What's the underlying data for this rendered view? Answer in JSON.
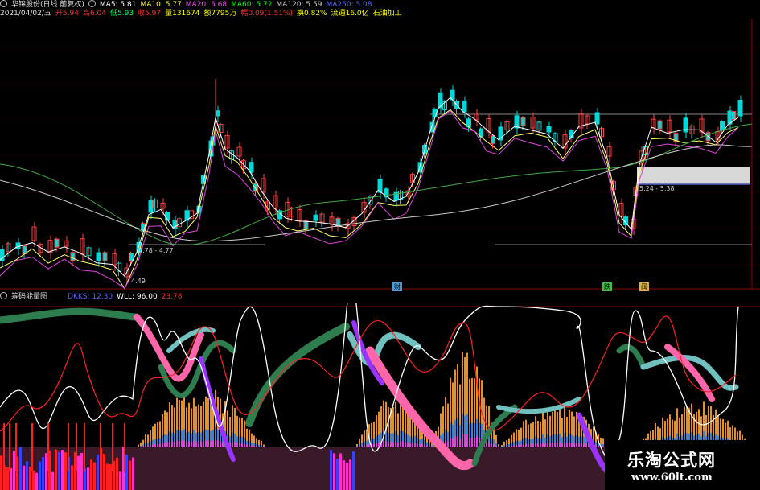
{
  "header": {
    "stock_name": "华锦股份(日线 前复权)",
    "ma_labels": [
      {
        "text": "MA5: 5.81",
        "color": "#ffffff"
      },
      {
        "text": "MA10: 5.77",
        "color": "#ffff00"
      },
      {
        "text": "MA20: 5.68",
        "color": "#ff44ff"
      },
      {
        "text": "MA60: 5.72",
        "color": "#00ff00"
      },
      {
        "text": "MA120: 5.59",
        "color": "#cccccc"
      },
      {
        "text": "MA250: 5.08",
        "color": "#5566ff"
      }
    ],
    "date": "2021/04/02/五",
    "quote": [
      {
        "label": "开",
        "value": "5.94",
        "color": "#ff3333"
      },
      {
        "label": "高",
        "value": "6.04",
        "color": "#ff3333"
      },
      {
        "label": "低",
        "value": "5.93",
        "color": "#00ff66"
      },
      {
        "label": "收",
        "value": "5.97",
        "color": "#ff3333"
      },
      {
        "label": "量",
        "value": "131674",
        "color": "#ffff00"
      },
      {
        "label": "额",
        "value": "7795万",
        "color": "#ffff00"
      },
      {
        "label": "幅",
        "value": "0.09(1.51%)",
        "color": "#ff3333"
      },
      {
        "label": "换",
        "value": "0.82%",
        "color": "#ffff00"
      },
      {
        "label": "流通",
        "value": "16.0亿",
        "color": "#ffff00"
      },
      {
        "label": "",
        "value": "石油加工",
        "color": "#ffff00"
      }
    ]
  },
  "price_annotations": {
    "low_label": "4.49",
    "range1": "4.78 - 4.77",
    "range2": "5.24 - 5.38"
  },
  "markers": [
    {
      "text": "财",
      "color": "#4a9cd8"
    },
    {
      "text": "跌",
      "color": "#40c040"
    },
    {
      "text": "阀",
      "color": "#e0b040"
    }
  ],
  "indicator": {
    "name": "筹码能量图",
    "items": [
      {
        "text": "DKKS: 12.30",
        "color": "#6060ff"
      },
      {
        "text": "WLL: 96.00",
        "color": "#ffffff"
      },
      {
        "text": "23.78",
        "color": "#ff3333"
      }
    ]
  },
  "watermark": {
    "name": "乐淘公式网",
    "url": "www.60lt.com"
  }
}
